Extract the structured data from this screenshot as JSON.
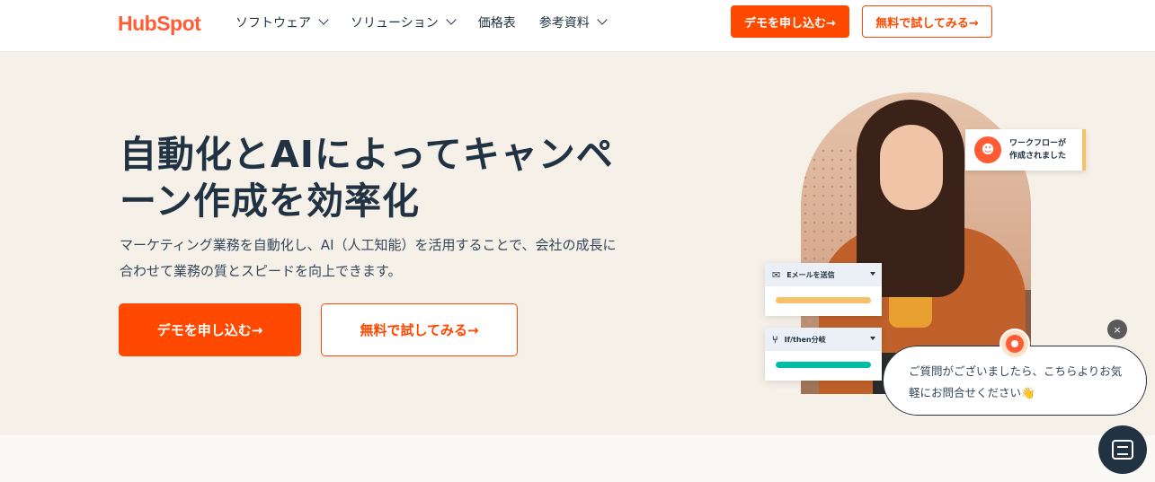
{
  "header": {
    "logo_text": "HubSpot",
    "nav": [
      {
        "label": "ソフトウェア",
        "has_dropdown": true
      },
      {
        "label": "ソリューション",
        "has_dropdown": true
      },
      {
        "label": "価格表",
        "has_dropdown": false
      },
      {
        "label": "参考資料",
        "has_dropdown": true
      }
    ],
    "demo_button": "デモを申し込む→",
    "free_button": "無料で試してみる→"
  },
  "hero": {
    "title": "自動化とAIによってキャンペーン作成を効率化",
    "subtitle": "マーケティング業務を自動化し、AI（人工知能）を活用することで、会社の成長に合わせて業務の質とスピードを向上できます。",
    "demo_button": "デモを申し込む→",
    "free_button": "無料で試してみる→"
  },
  "illustration": {
    "workflow_badge_line1": "ワークフローが",
    "workflow_badge_line2": "作成されました",
    "email_card_label": "Eメールを送信",
    "branch_card_label": "If/then分岐",
    "email_bar_color": "#f5c26b",
    "branch_bar_color": "#00bda5"
  },
  "chat": {
    "message": "ご質問がございましたら、こちらよりお気軽にお問合せください👋",
    "close_label": "×"
  },
  "colors": {
    "brand": "#ff4800",
    "hero_bg": "#f5f0e8",
    "text": "#213343"
  }
}
